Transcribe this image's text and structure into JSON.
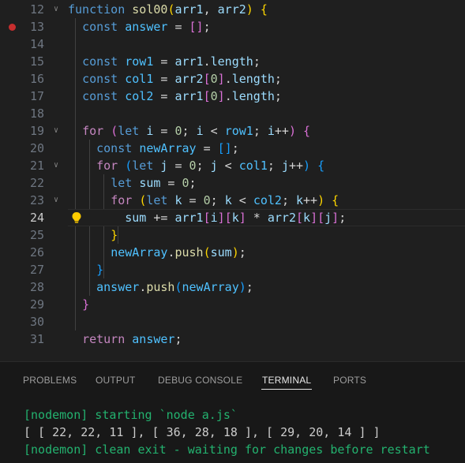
{
  "editor": {
    "breakpoint_line": "13",
    "current_line": "24",
    "lines": [
      {
        "n": "12",
        "tokens": [
          {
            "t": "function",
            "c": "kw"
          },
          {
            "t": " ",
            "c": "txt"
          },
          {
            "t": "sol00",
            "c": "fn"
          },
          {
            "t": "(",
            "c": "b1"
          },
          {
            "t": "arr1",
            "c": "var"
          },
          {
            "t": ", ",
            "c": "txt"
          },
          {
            "t": "arr2",
            "c": "var"
          },
          {
            "t": ")",
            "c": "b1"
          },
          {
            "t": " ",
            "c": "txt"
          },
          {
            "t": "{",
            "c": "b1"
          }
        ]
      },
      {
        "n": "13",
        "tokens": [
          {
            "t": "  ",
            "c": "txt"
          },
          {
            "t": "const",
            "c": "kw"
          },
          {
            "t": " ",
            "c": "txt"
          },
          {
            "t": "answer",
            "c": "cst"
          },
          {
            "t": " = ",
            "c": "txt"
          },
          {
            "t": "[]",
            "c": "b2"
          },
          {
            "t": ";",
            "c": "txt"
          }
        ]
      },
      {
        "n": "14",
        "tokens": []
      },
      {
        "n": "15",
        "tokens": [
          {
            "t": "  ",
            "c": "txt"
          },
          {
            "t": "const",
            "c": "kw"
          },
          {
            "t": " ",
            "c": "txt"
          },
          {
            "t": "row1",
            "c": "cst"
          },
          {
            "t": " = ",
            "c": "txt"
          },
          {
            "t": "arr1",
            "c": "var"
          },
          {
            "t": ".",
            "c": "txt"
          },
          {
            "t": "length",
            "c": "var"
          },
          {
            "t": ";",
            "c": "txt"
          }
        ]
      },
      {
        "n": "16",
        "tokens": [
          {
            "t": "  ",
            "c": "txt"
          },
          {
            "t": "const",
            "c": "kw"
          },
          {
            "t": " ",
            "c": "txt"
          },
          {
            "t": "col1",
            "c": "cst"
          },
          {
            "t": " = ",
            "c": "txt"
          },
          {
            "t": "arr2",
            "c": "var"
          },
          {
            "t": "[",
            "c": "b2"
          },
          {
            "t": "0",
            "c": "num"
          },
          {
            "t": "]",
            "c": "b2"
          },
          {
            "t": ".",
            "c": "txt"
          },
          {
            "t": "length",
            "c": "var"
          },
          {
            "t": ";",
            "c": "txt"
          }
        ]
      },
      {
        "n": "17",
        "tokens": [
          {
            "t": "  ",
            "c": "txt"
          },
          {
            "t": "const",
            "c": "kw"
          },
          {
            "t": " ",
            "c": "txt"
          },
          {
            "t": "col2",
            "c": "cst"
          },
          {
            "t": " = ",
            "c": "txt"
          },
          {
            "t": "arr1",
            "c": "var"
          },
          {
            "t": "[",
            "c": "b2"
          },
          {
            "t": "0",
            "c": "num"
          },
          {
            "t": "]",
            "c": "b2"
          },
          {
            "t": ".",
            "c": "txt"
          },
          {
            "t": "length",
            "c": "var"
          },
          {
            "t": ";",
            "c": "txt"
          }
        ]
      },
      {
        "n": "18",
        "tokens": []
      },
      {
        "n": "19",
        "tokens": [
          {
            "t": "  ",
            "c": "txt"
          },
          {
            "t": "for",
            "c": "ctl"
          },
          {
            "t": " ",
            "c": "txt"
          },
          {
            "t": "(",
            "c": "b2"
          },
          {
            "t": "let",
            "c": "kw"
          },
          {
            "t": " ",
            "c": "txt"
          },
          {
            "t": "i",
            "c": "var"
          },
          {
            "t": " = ",
            "c": "txt"
          },
          {
            "t": "0",
            "c": "num"
          },
          {
            "t": "; ",
            "c": "txt"
          },
          {
            "t": "i",
            "c": "var"
          },
          {
            "t": " < ",
            "c": "txt"
          },
          {
            "t": "row1",
            "c": "cst"
          },
          {
            "t": "; ",
            "c": "txt"
          },
          {
            "t": "i",
            "c": "var"
          },
          {
            "t": "++",
            "c": "txt"
          },
          {
            "t": ")",
            "c": "b2"
          },
          {
            "t": " ",
            "c": "txt"
          },
          {
            "t": "{",
            "c": "b2"
          }
        ]
      },
      {
        "n": "20",
        "tokens": [
          {
            "t": "    ",
            "c": "txt"
          },
          {
            "t": "const",
            "c": "kw"
          },
          {
            "t": " ",
            "c": "txt"
          },
          {
            "t": "newArray",
            "c": "cst"
          },
          {
            "t": " = ",
            "c": "txt"
          },
          {
            "t": "[]",
            "c": "b3"
          },
          {
            "t": ";",
            "c": "txt"
          }
        ]
      },
      {
        "n": "21",
        "tokens": [
          {
            "t": "    ",
            "c": "txt"
          },
          {
            "t": "for",
            "c": "ctl"
          },
          {
            "t": " ",
            "c": "txt"
          },
          {
            "t": "(",
            "c": "b3"
          },
          {
            "t": "let",
            "c": "kw"
          },
          {
            "t": " ",
            "c": "txt"
          },
          {
            "t": "j",
            "c": "var"
          },
          {
            "t": " = ",
            "c": "txt"
          },
          {
            "t": "0",
            "c": "num"
          },
          {
            "t": "; ",
            "c": "txt"
          },
          {
            "t": "j",
            "c": "var"
          },
          {
            "t": " < ",
            "c": "txt"
          },
          {
            "t": "col1",
            "c": "cst"
          },
          {
            "t": "; ",
            "c": "txt"
          },
          {
            "t": "j",
            "c": "var"
          },
          {
            "t": "++",
            "c": "txt"
          },
          {
            "t": ")",
            "c": "b3"
          },
          {
            "t": " ",
            "c": "txt"
          },
          {
            "t": "{",
            "c": "b3"
          }
        ]
      },
      {
        "n": "22",
        "tokens": [
          {
            "t": "      ",
            "c": "txt"
          },
          {
            "t": "let",
            "c": "kw"
          },
          {
            "t": " ",
            "c": "txt"
          },
          {
            "t": "sum",
            "c": "var"
          },
          {
            "t": " = ",
            "c": "txt"
          },
          {
            "t": "0",
            "c": "num"
          },
          {
            "t": ";",
            "c": "txt"
          }
        ]
      },
      {
        "n": "23",
        "tokens": [
          {
            "t": "      ",
            "c": "txt"
          },
          {
            "t": "for",
            "c": "ctl"
          },
          {
            "t": " ",
            "c": "txt"
          },
          {
            "t": "(",
            "c": "b1"
          },
          {
            "t": "let",
            "c": "kw"
          },
          {
            "t": " ",
            "c": "txt"
          },
          {
            "t": "k",
            "c": "var"
          },
          {
            "t": " = ",
            "c": "txt"
          },
          {
            "t": "0",
            "c": "num"
          },
          {
            "t": "; ",
            "c": "txt"
          },
          {
            "t": "k",
            "c": "var"
          },
          {
            "t": " < ",
            "c": "txt"
          },
          {
            "t": "col2",
            "c": "cst"
          },
          {
            "t": "; ",
            "c": "txt"
          },
          {
            "t": "k",
            "c": "var"
          },
          {
            "t": "++",
            "c": "txt"
          },
          {
            "t": ")",
            "c": "b1"
          },
          {
            "t": " ",
            "c": "txt"
          },
          {
            "t": "{",
            "c": "b1"
          }
        ]
      },
      {
        "n": "24",
        "tokens": [
          {
            "t": "        ",
            "c": "txt"
          },
          {
            "t": "sum",
            "c": "var"
          },
          {
            "t": " += ",
            "c": "txt"
          },
          {
            "t": "arr1",
            "c": "var"
          },
          {
            "t": "[",
            "c": "b2"
          },
          {
            "t": "i",
            "c": "var"
          },
          {
            "t": "]",
            "c": "b2"
          },
          {
            "t": "[",
            "c": "b2"
          },
          {
            "t": "k",
            "c": "var"
          },
          {
            "t": "]",
            "c": "b2"
          },
          {
            "t": " * ",
            "c": "txt"
          },
          {
            "t": "arr2",
            "c": "var"
          },
          {
            "t": "[",
            "c": "b2"
          },
          {
            "t": "k",
            "c": "var"
          },
          {
            "t": "]",
            "c": "b2"
          },
          {
            "t": "[",
            "c": "b2"
          },
          {
            "t": "j",
            "c": "var"
          },
          {
            "t": "]",
            "c": "b2"
          },
          {
            "t": ";",
            "c": "txt"
          }
        ]
      },
      {
        "n": "25",
        "tokens": [
          {
            "t": "      ",
            "c": "txt"
          },
          {
            "t": "}",
            "c": "b1"
          }
        ]
      },
      {
        "n": "26",
        "tokens": [
          {
            "t": "      ",
            "c": "txt"
          },
          {
            "t": "newArray",
            "c": "cst"
          },
          {
            "t": ".",
            "c": "txt"
          },
          {
            "t": "push",
            "c": "fn"
          },
          {
            "t": "(",
            "c": "b1"
          },
          {
            "t": "sum",
            "c": "var"
          },
          {
            "t": ")",
            "c": "b1"
          },
          {
            "t": ";",
            "c": "txt"
          }
        ]
      },
      {
        "n": "27",
        "tokens": [
          {
            "t": "    ",
            "c": "txt"
          },
          {
            "t": "}",
            "c": "b3"
          }
        ]
      },
      {
        "n": "28",
        "tokens": [
          {
            "t": "    ",
            "c": "txt"
          },
          {
            "t": "answer",
            "c": "cst"
          },
          {
            "t": ".",
            "c": "txt"
          },
          {
            "t": "push",
            "c": "fn"
          },
          {
            "t": "(",
            "c": "b3"
          },
          {
            "t": "newArray",
            "c": "cst"
          },
          {
            "t": ")",
            "c": "b3"
          },
          {
            "t": ";",
            "c": "txt"
          }
        ]
      },
      {
        "n": "29",
        "tokens": [
          {
            "t": "  ",
            "c": "txt"
          },
          {
            "t": "}",
            "c": "b2"
          }
        ]
      },
      {
        "n": "30",
        "tokens": []
      },
      {
        "n": "31",
        "tokens": [
          {
            "t": "  ",
            "c": "txt"
          },
          {
            "t": "return",
            "c": "ctl"
          },
          {
            "t": " ",
            "c": "txt"
          },
          {
            "t": "answer",
            "c": "cst"
          },
          {
            "t": ";",
            "c": "txt"
          }
        ]
      }
    ]
  },
  "panel": {
    "tabs": [
      "PROBLEMS",
      "OUTPUT",
      "DEBUG CONSOLE",
      "TERMINAL",
      "PORTS"
    ],
    "active_tab": "TERMINAL",
    "terminal_lines": [
      "[nodemon] starting `node a.js`",
      "[ [ 22, 22, 11 ], [ 36, 28, 18 ], [ 29, 20, 14 ] ]",
      "[nodemon] clean exit - waiting for changes before restart"
    ]
  },
  "icons": {
    "fold": "chevron-down-icon",
    "breakpoint": "breakpoint-icon",
    "lightbulb": "lightbulb-icon"
  },
  "colors": {
    "editor_bg": "#1f1f1f",
    "panel_bg": "#181818",
    "terminal_green": "#23b26f",
    "breakpoint": "#c72e2e",
    "lightbulb": "#ffcc00"
  }
}
